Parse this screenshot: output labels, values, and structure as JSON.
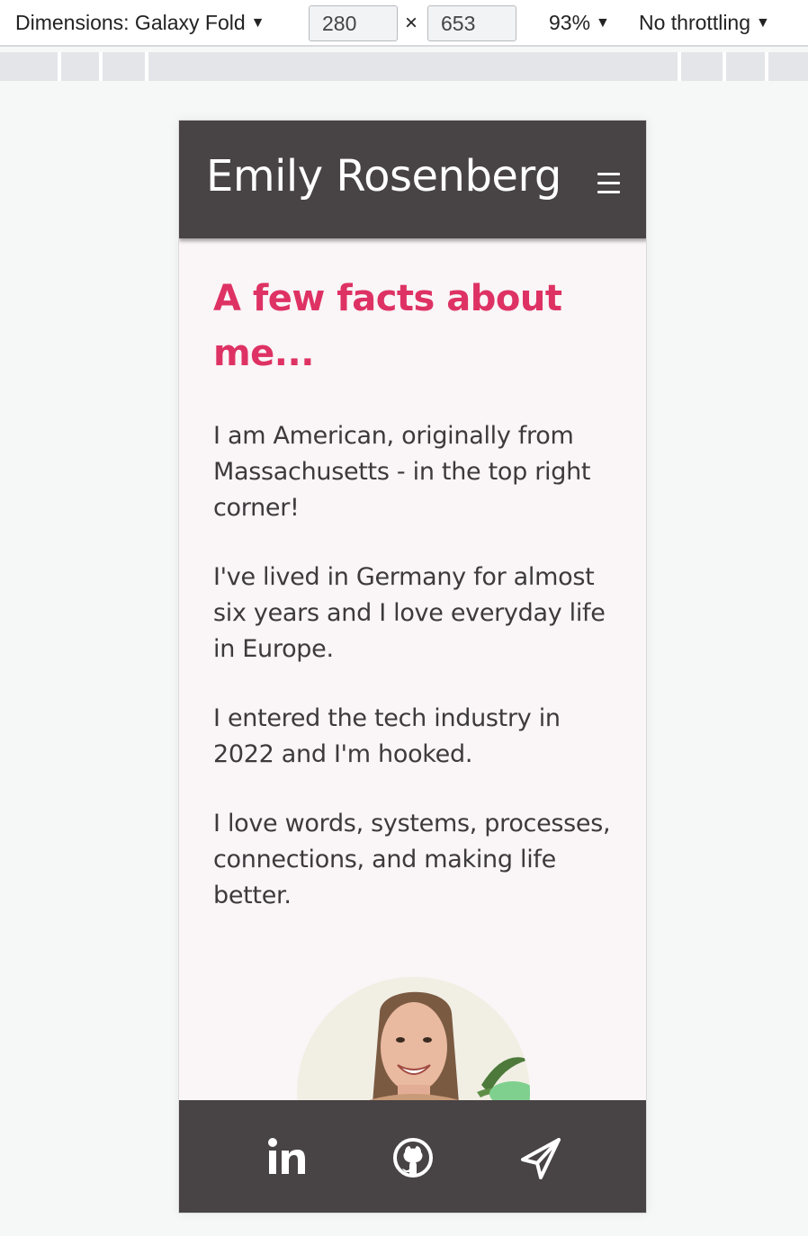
{
  "devtools": {
    "dimensions_label": "Dimensions: Galaxy Fold",
    "width_value": "280",
    "height_value": "653",
    "times_symbol": "×",
    "zoom": "93%",
    "throttling": "No throttling",
    "caret": "▼"
  },
  "site": {
    "title": "Emily Rosenberg",
    "menu_icon": "hamburger-menu-icon",
    "heading": "A few facts about me...",
    "paragraphs": [
      "I am American, originally from Massachusetts - in the top right corner!",
      "I've lived in Germany for almost six years and I love everyday life in Europe.",
      "I entered the tech industry in 2022 and I'm hooked.",
      "I love words, systems, processes, connections, and making life better."
    ],
    "footer_icons": [
      "linkedin-icon",
      "github-icon",
      "send-icon"
    ]
  },
  "colors": {
    "header_bg": "#484345",
    "page_bg": "#faf5f7",
    "accent": "#de3264",
    "text": "#3d3a3c"
  }
}
